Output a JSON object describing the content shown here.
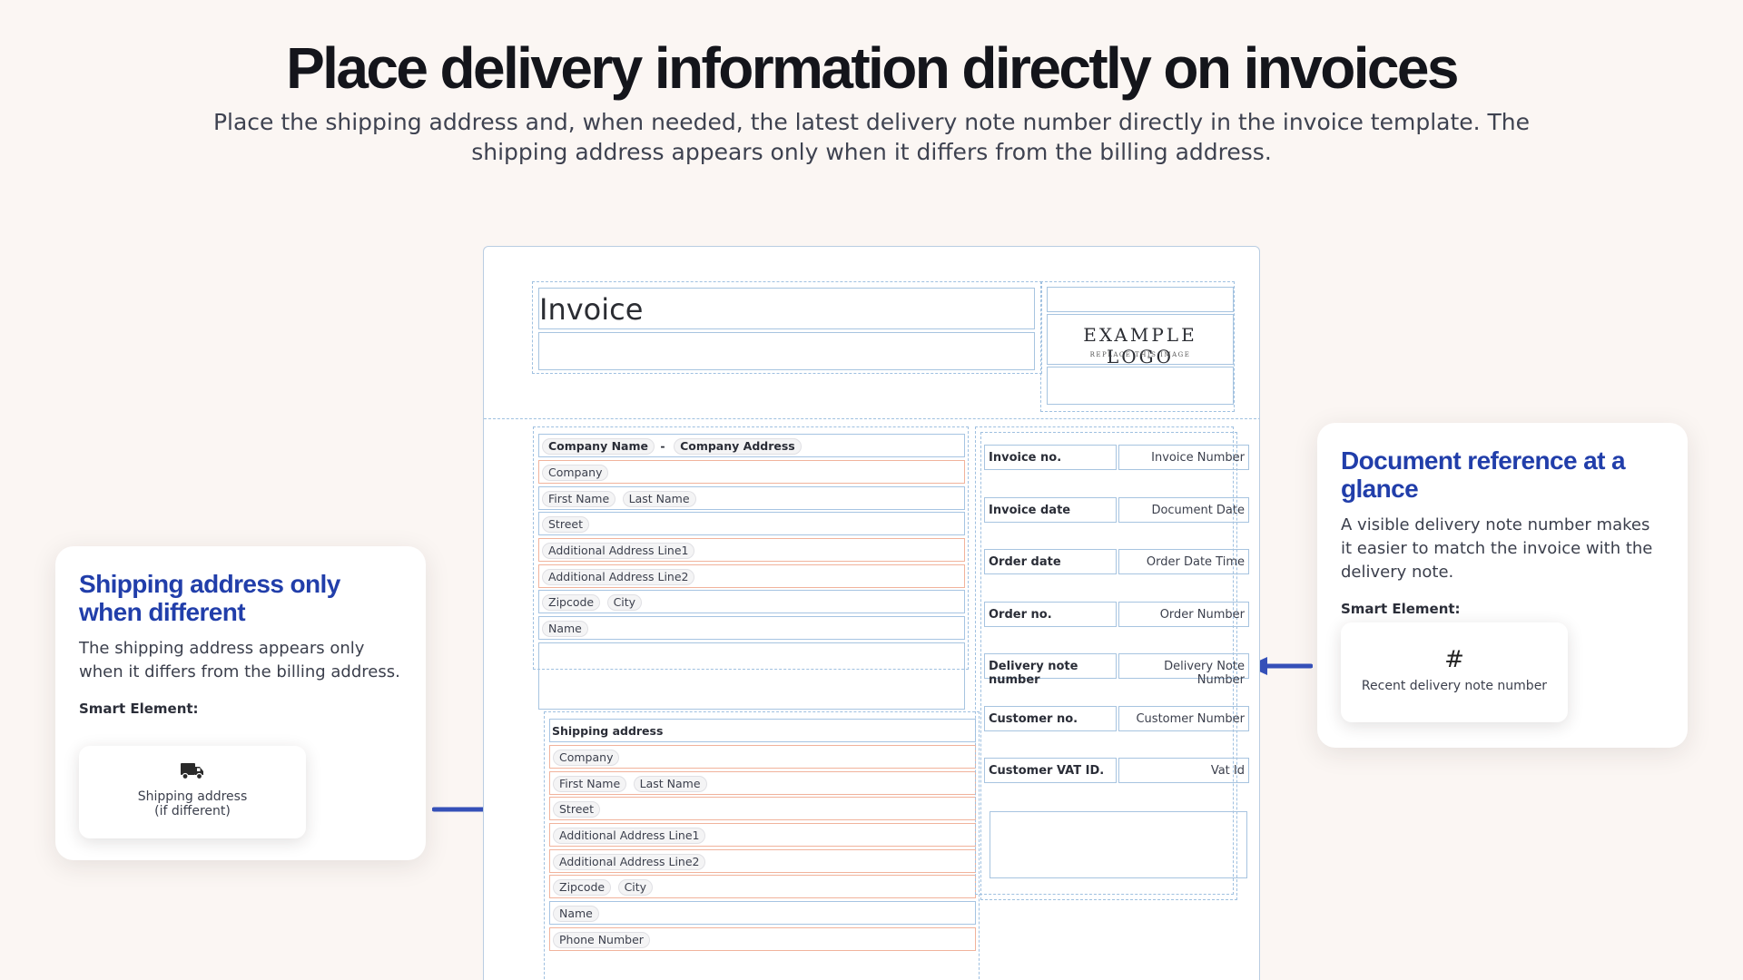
{
  "hero": {
    "title": "Place delivery information directly on invoices",
    "subtitle": "Place the shipping address and, when needed, the latest delivery note number directly in the invoice template. The shipping address appears only when it differs from the billing address."
  },
  "left_card": {
    "title": "Shipping address only when different",
    "description": "The shipping address appears only when it differs from the billing address.",
    "smart_label": "Smart Element:",
    "smart_element": {
      "icon": "truck-icon",
      "line1": "Shipping address",
      "line2": "(if different)"
    }
  },
  "right_card": {
    "title": "Document reference at a glance",
    "description": "A visible delivery note number makes it easier to match the invoice with the delivery note.",
    "smart_label": "Smart Element:",
    "smart_element": {
      "icon": "hash-icon",
      "symbol": "#",
      "line1": "Recent delivery note number"
    }
  },
  "invoice": {
    "title": "Invoice",
    "logo": {
      "text": "EXAMPLE LOGO",
      "subtext": "REPLACE THIS IMAGE"
    },
    "sender": {
      "company_name": "Company Name",
      "separator": "-",
      "company_address": "Company Address"
    },
    "billing": {
      "company": "Company",
      "first_name": "First Name",
      "last_name": "Last Name",
      "street": "Street",
      "address_line1": "Additional Address Line1",
      "address_line2": "Additional Address Line2",
      "zipcode": "Zipcode",
      "city": "City",
      "name": "Name"
    },
    "shipping": {
      "heading": "Shipping address",
      "company": "Company",
      "first_name": "First Name",
      "last_name": "Last Name",
      "street": "Street",
      "address_line1": "Additional Address Line1",
      "address_line2": "Additional Address Line2",
      "zipcode": "Zipcode",
      "city": "City",
      "name": "Name",
      "phone": "Phone Number"
    },
    "info_rows": [
      {
        "label": "Invoice no.",
        "value": "Invoice Number"
      },
      {
        "label": "Invoice date",
        "value": "Document Date"
      },
      {
        "label": "Order date",
        "value": "Order Date Time"
      },
      {
        "label": "Order no.",
        "value": "Order Number"
      },
      {
        "label": "Delivery note number",
        "value": "Delivery Note Number"
      },
      {
        "label": "Customer no.",
        "value": "Customer Number"
      },
      {
        "label": "Customer VAT ID.",
        "value": "Vat Id"
      }
    ]
  },
  "colors": {
    "accent": "#213eaa",
    "arrow": "#3550b8",
    "background": "#fbf6f3"
  }
}
